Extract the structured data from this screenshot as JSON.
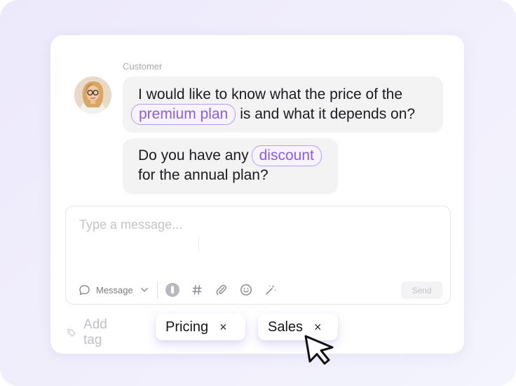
{
  "chat": {
    "sender_label": "Customer",
    "messages": [
      {
        "line1": "I would like to know what the price of the",
        "line2_keyword": "premium plan",
        "line2_rest": "is and what it depends on?"
      },
      {
        "line1_pre": "Do you have any",
        "line1_keyword": "discount",
        "line2": "for the annual plan?"
      }
    ]
  },
  "composer": {
    "placeholder": "Type a message...",
    "mode_label": "Message",
    "send_label": "Send"
  },
  "tags": {
    "add_label": "Add tag",
    "items": [
      {
        "label": "Pricing",
        "remove": "×"
      },
      {
        "label": "Sales",
        "remove": "×"
      }
    ]
  },
  "colors": {
    "accent": "#8b5cf0",
    "keyword_border": "#b79cf6",
    "bubble_bg": "#f3f3f4",
    "page_bg": "#ece9fb"
  },
  "icons": [
    "avatar-portrait",
    "chat-bubble-icon",
    "chevron-down-icon",
    "voice-icon",
    "hashtag-icon",
    "paperclip-icon",
    "emoji-icon",
    "magic-wand-icon",
    "tag-icon",
    "close-icon",
    "mouse-pointer-icon"
  ]
}
